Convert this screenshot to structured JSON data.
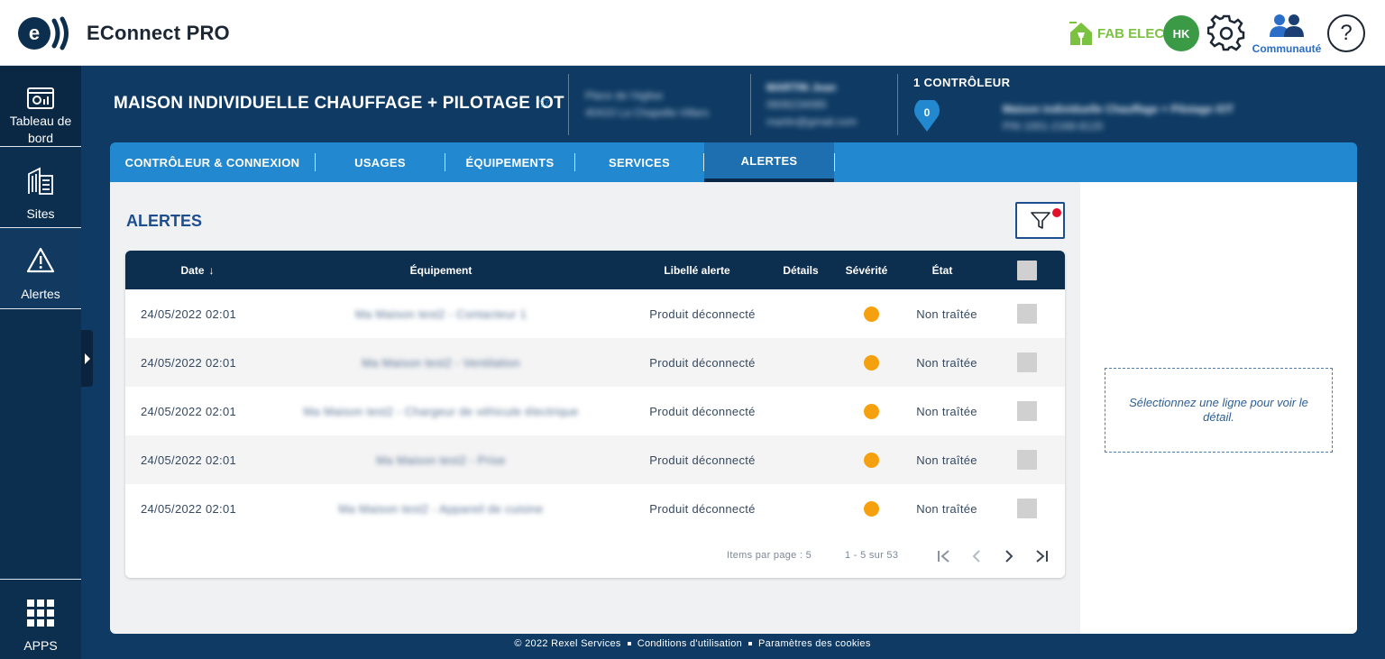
{
  "app": {
    "title": "EConnect PRO"
  },
  "header_right": {
    "fab_elec": "FAB ELEC",
    "avatar_initials": "HK",
    "community_label": "Communauté",
    "help_symbol": "?"
  },
  "sidebar": {
    "items": [
      {
        "label": "Tableau de bord",
        "icon": "dashboard-icon"
      },
      {
        "label": "Sites",
        "icon": "building-icon"
      },
      {
        "label": "Alertes",
        "icon": "warning-icon"
      }
    ],
    "apps_label": "APPS"
  },
  "project": {
    "title": "MAISON INDIVIDUELLE CHAUFFAGE + PILOTAGE IOT",
    "address_line1": "Place de l'église",
    "address_line2": "40410 La Chapelle-Villars",
    "owner_name": "MARTIN Jean",
    "owner_phone": "0606234085",
    "owner_email": "martin@gmail.com",
    "controller_count_label": "1 CONTRÔLEUR",
    "controller_pin_count": "0",
    "controller_name": "Maison individuelle Chauffage + Pilotage IOT",
    "controller_pin": "PIN 1001-2168-8120"
  },
  "tabs": [
    {
      "label": "CONTRÔLEUR & CONNEXION",
      "active": false
    },
    {
      "label": "USAGES",
      "active": false
    },
    {
      "label": "ÉQUIPEMENTS",
      "active": false
    },
    {
      "label": "SERVICES",
      "active": false
    },
    {
      "label": "ALERTES",
      "active": true
    }
  ],
  "alerts": {
    "title": "ALERTES",
    "columns": {
      "date": "Date",
      "date_sort": "↓",
      "equipment": "Équipement",
      "label": "Libellé alerte",
      "details": "Détails",
      "severity": "Sévérité",
      "state": "État"
    },
    "rows": [
      {
        "date": "24/05/2022 02:01",
        "equipment": "Ma Maison test2 - Contacteur 1",
        "label": "Produit déconnecté",
        "details": "",
        "severity_color": "#f5a10f",
        "state": "Non traîtée"
      },
      {
        "date": "24/05/2022 02:01",
        "equipment": "Ma Maison test2 - Ventilation",
        "label": "Produit déconnecté",
        "details": "",
        "severity_color": "#f5a10f",
        "state": "Non traîtée"
      },
      {
        "date": "24/05/2022 02:01",
        "equipment": "Ma Maison test2 - Chargeur de véhicule électrique",
        "label": "Produit déconnecté",
        "details": "",
        "severity_color": "#f5a10f",
        "state": "Non traîtée"
      },
      {
        "date": "24/05/2022 02:01",
        "equipment": "Ma Maison test2 - Prise",
        "label": "Produit déconnecté",
        "details": "",
        "severity_color": "#f5a10f",
        "state": "Non traîtée"
      },
      {
        "date": "24/05/2022 02:01",
        "equipment": "Ma Maison test2 - Appareil de cuisine",
        "label": "Produit déconnecté",
        "details": "",
        "severity_color": "#f5a10f",
        "state": "Non traîtée"
      }
    ],
    "pager": {
      "items_per_page": "Items par page : 5",
      "range": "1 - 5 sur 53"
    }
  },
  "detail_placeholder": "Sélectionnez une ligne pour voir le détail.",
  "footer": {
    "copyright": "© 2022 Rexel Services",
    "terms": "Conditions d'utilisation",
    "cookies": "Paramètres des cookies"
  },
  "colors": {
    "navy": "#0d2f4f",
    "tab_blue": "#2288cf",
    "severity_orange": "#f5a10f",
    "filter_badge": "#e0112b"
  }
}
